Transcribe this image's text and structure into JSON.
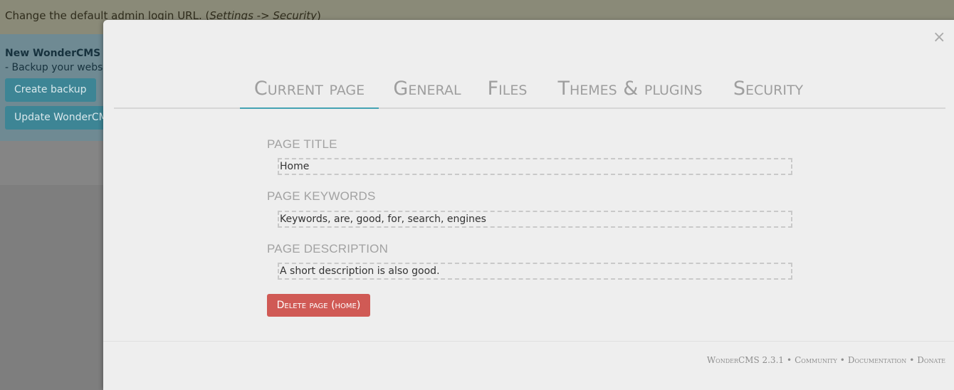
{
  "background": {
    "alert": {
      "prefix": "Change the default admin login URL. (",
      "path": "Settings -> Security",
      "suffix": ")"
    },
    "update": {
      "title": "New WonderCMS",
      "text": "- Backup your webs",
      "backup_button": "Create backup",
      "update_button": "Update WonderCMS"
    }
  },
  "modal": {
    "close_glyph": "×",
    "tabs": [
      {
        "label": "Current page"
      },
      {
        "label": "General"
      },
      {
        "label": "Files"
      },
      {
        "label": "Themes & plugins"
      },
      {
        "label": "Security"
      }
    ],
    "fields": {
      "title": {
        "label": "PAGE TITLE",
        "value": "Home"
      },
      "keywords": {
        "label": "PAGE KEYWORDS",
        "value": "Keywords, are, good, for, search, engines"
      },
      "description": {
        "label": "PAGE DESCRIPTION",
        "value": "A short description is also good."
      }
    },
    "delete_button": "Delete page (home)",
    "footer": {
      "version": "WonderCMS 2.3.1",
      "separator": "•",
      "links": [
        "Community",
        "Documentation",
        "Donate"
      ]
    }
  },
  "colors": {
    "accent": "#45a3b3",
    "danger": "#d05a55"
  }
}
